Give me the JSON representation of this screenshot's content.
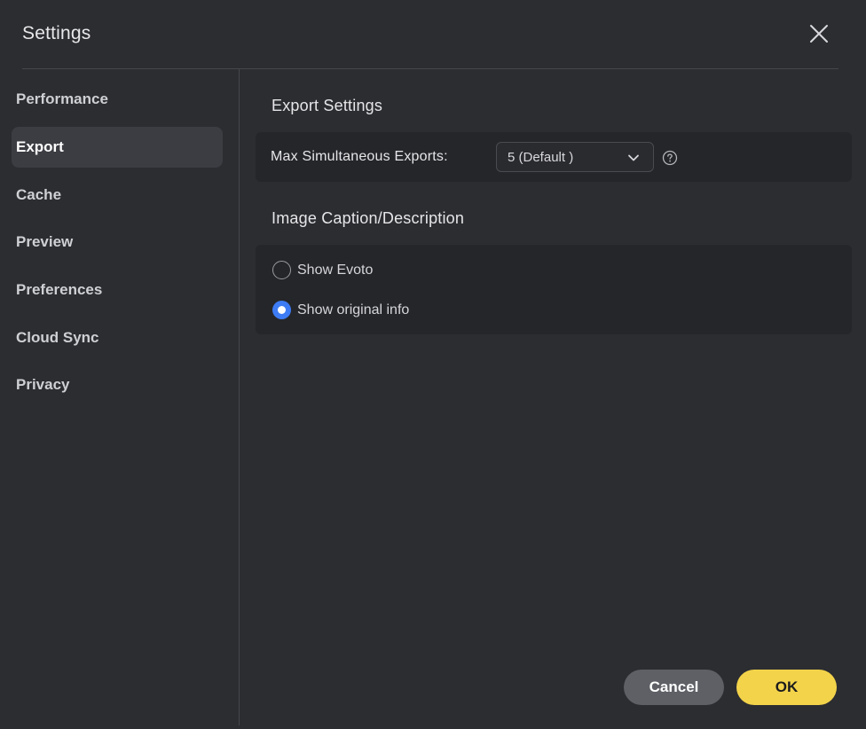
{
  "window": {
    "title": "Settings"
  },
  "sidebar": {
    "items": [
      {
        "label": "Performance",
        "active": false
      },
      {
        "label": "Export",
        "active": true
      },
      {
        "label": "Cache",
        "active": false
      },
      {
        "label": "Preview",
        "active": false
      },
      {
        "label": "Preferences",
        "active": false
      },
      {
        "label": "Cloud Sync",
        "active": false
      },
      {
        "label": "Privacy",
        "active": false
      }
    ]
  },
  "export_settings": {
    "title": "Export Settings",
    "max_exports_label": "Max Simultaneous Exports:",
    "max_exports_value": "5 (Default )"
  },
  "caption": {
    "title": "Image Caption/Description",
    "options": [
      {
        "label": "Show Evoto",
        "checked": false
      },
      {
        "label": "Show original info",
        "checked": true
      }
    ]
  },
  "footer": {
    "cancel_label": "Cancel",
    "ok_label": "OK"
  },
  "colors": {
    "background": "#2c2d31",
    "panel": "#25262a",
    "accent_radio": "#3d7cf4",
    "ok_button": "#f3d34a",
    "cancel_button": "#5e6066"
  },
  "icons": {
    "close": "close-icon",
    "dropdown": "chevron-down-icon",
    "help": "help-circle-icon"
  }
}
